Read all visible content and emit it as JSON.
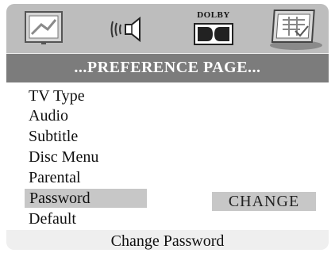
{
  "icons": [
    {
      "name": "general-setup-icon",
      "label": ""
    },
    {
      "name": "audio-setup-icon",
      "label": ""
    },
    {
      "name": "dolby-icon",
      "label": "DOLBY"
    },
    {
      "name": "preference-icon",
      "label": ""
    }
  ],
  "header": {
    "title": "...PREFERENCE PAGE..."
  },
  "menu": {
    "items": [
      "TV Type",
      "Audio",
      "Subtitle",
      "Disc Menu",
      "Parental",
      "Password",
      "Default"
    ],
    "selected_index": 5,
    "selected_value": "CHANGE"
  },
  "footer": {
    "help": "Change Password"
  },
  "colors": {
    "icon_bar": "#bdbdbd",
    "header_bar": "#7c7c7c",
    "highlight": "#c7c7c7"
  }
}
